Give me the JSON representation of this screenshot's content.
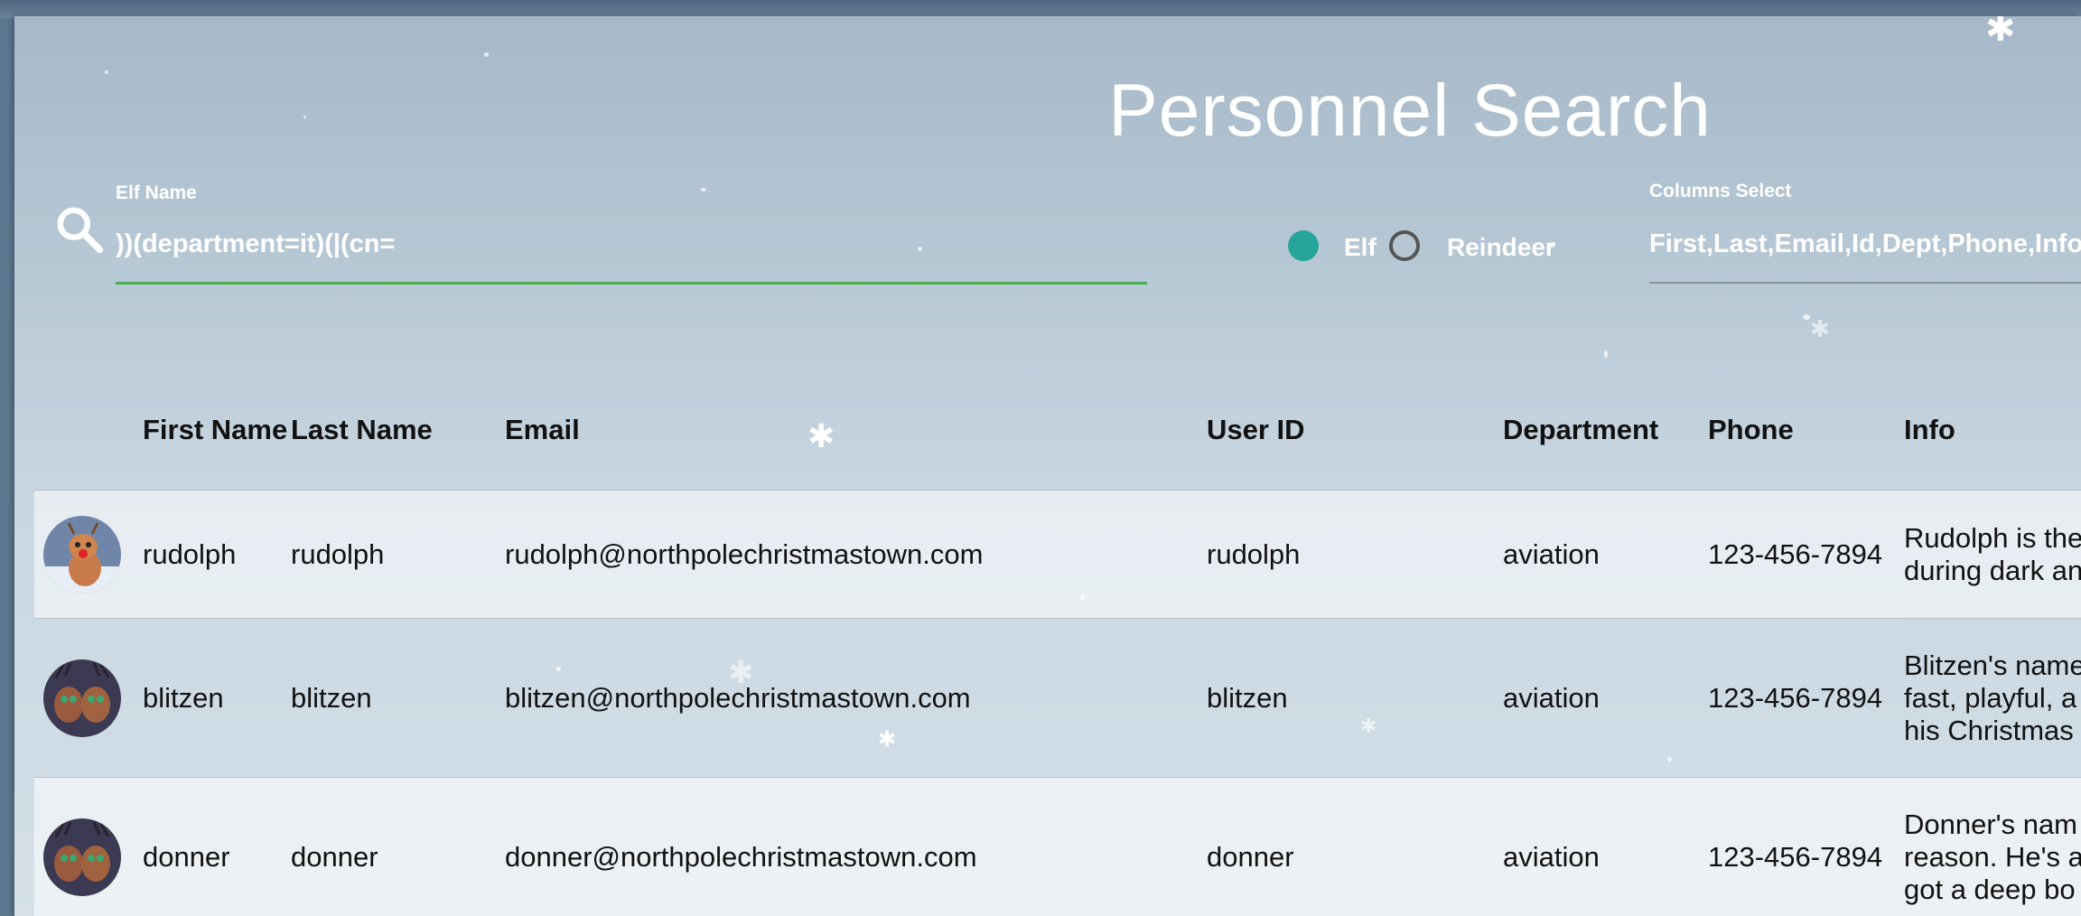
{
  "page": {
    "title": "Personnel Search"
  },
  "search": {
    "label": "Elf Name",
    "value": "))(department=it)(|(cn=",
    "icon": "search-icon"
  },
  "type_toggle": {
    "options": [
      {
        "label": "Elf",
        "selected": true
      },
      {
        "label": "Reindeer",
        "selected": false
      }
    ],
    "accent_color": "#26a69a"
  },
  "columns_select": {
    "label": "Columns Select",
    "value": "First,Last,Email,Id,Dept,Phone,Info"
  },
  "table": {
    "headers": {
      "first": "First Name",
      "last": "Last Name",
      "email": "Email",
      "user_id": "User ID",
      "department": "Department",
      "phone": "Phone",
      "info": "Info"
    },
    "rows": [
      {
        "avatar": "rudolph-avatar",
        "first": "rudolph",
        "last": "rudolph",
        "email": "rudolph@northpolechristmastown.com",
        "user_id": "rudolph",
        "department": "aviation",
        "phone": "123-456-7894",
        "info": "Rudolph is the\nduring dark an"
      },
      {
        "avatar": "blitzen-avatar",
        "first": "blitzen",
        "last": "blitzen",
        "email": "blitzen@northpolechristmastown.com",
        "user_id": "blitzen",
        "department": "aviation",
        "phone": "123-456-7894",
        "info": "Blitzen's name\nfast, playful, a\nhis Christmas"
      },
      {
        "avatar": "donner-avatar",
        "first": "donner",
        "last": "donner",
        "email": "donner@northpolechristmastown.com",
        "user_id": "donner",
        "department": "aviation",
        "phone": "123-456-7894",
        "info": "Donner's nam\nreason. He's a\ngot a deep bo"
      }
    ]
  },
  "colors": {
    "focus_underline": "#4caf50",
    "idle_underline": "#8a96a0"
  }
}
